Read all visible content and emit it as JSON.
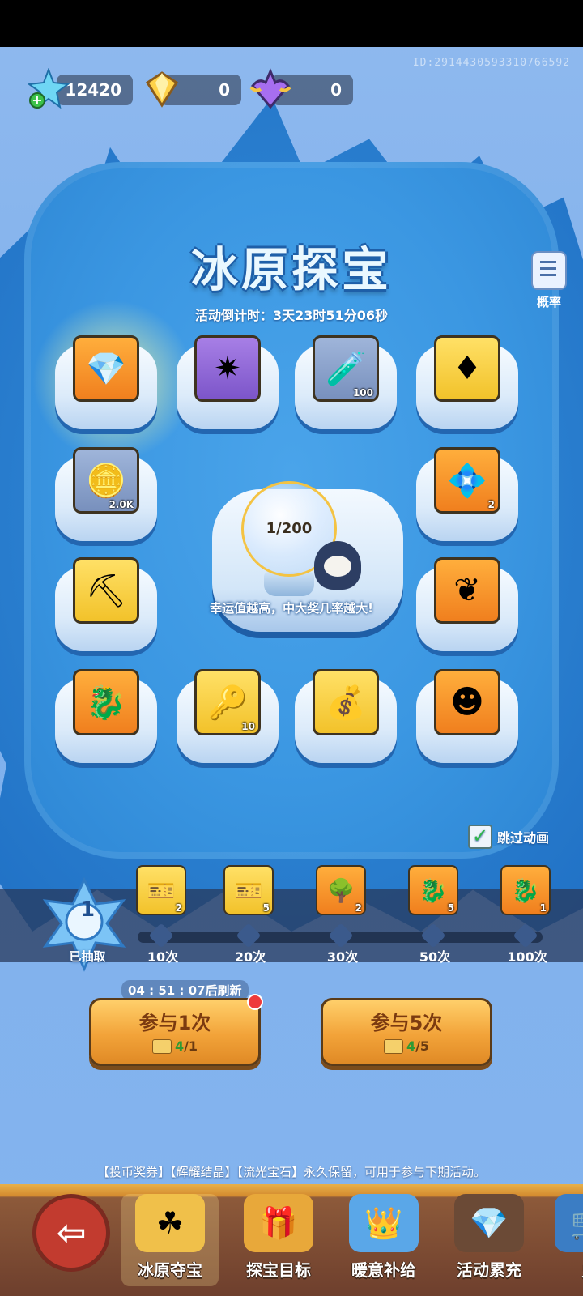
{
  "currency": {
    "snow_crystal": "12420",
    "gold_gem": "0",
    "purple_gem": "0"
  },
  "uid": "ID:2914430593310766592",
  "title": "冰原探宝",
  "countdown": "活动倒计时：3天23时51分06秒",
  "probability_label": "概率",
  "rewards": [
    {
      "icon": "purple-winged-gem-icon",
      "glyph": "💎",
      "color": "orange",
      "count": ""
    },
    {
      "icon": "star-shield-icon",
      "glyph": "✷",
      "color": "purple",
      "count": ""
    },
    {
      "icon": "potion-icon",
      "glyph": "🧪",
      "color": "blue",
      "count": "100"
    },
    {
      "icon": "gold-winged-gem-icon",
      "glyph": "♦",
      "color": "yellow",
      "count": ""
    },
    {
      "icon": "gold-coin-icon",
      "glyph": "🪙",
      "color": "blue",
      "count": "2.0K"
    },
    {
      "icon": "gold-crystal-icon",
      "glyph": "💠",
      "color": "orange",
      "count": "2"
    },
    {
      "icon": "pickaxe-icon",
      "glyph": "⛏",
      "color": "yellow",
      "count": ""
    },
    {
      "icon": "gold-wing-icon",
      "glyph": "❦",
      "color": "orange",
      "count": ""
    },
    {
      "icon": "dragon-puzzle-icon",
      "glyph": "🐉",
      "color": "orange",
      "count": ""
    },
    {
      "icon": "gold-key-icon",
      "glyph": "🔑",
      "color": "yellow",
      "count": "10"
    },
    {
      "icon": "coin-bag-icon",
      "glyph": "💰",
      "color": "yellow",
      "count": ""
    },
    {
      "icon": "purple-spirit-icon",
      "glyph": "☻",
      "color": "orange",
      "count": ""
    }
  ],
  "luck_value": "1/200",
  "luck_hint": "幸运值越高，中大奖几率越大!",
  "skip_animation": "跳过动画",
  "draw_count": "1",
  "draw_count_label": "已抽取",
  "milestones": [
    {
      "label": "10次",
      "icon": "ticket-icon",
      "glyph": "🎫",
      "count": "2",
      "color": "y"
    },
    {
      "label": "20次",
      "icon": "ticket-icon",
      "glyph": "🎫",
      "count": "5",
      "color": "y"
    },
    {
      "label": "30次",
      "icon": "tree-icon",
      "glyph": "🌳",
      "count": "2",
      "color": ""
    },
    {
      "label": "50次",
      "icon": "dragon-puzzle-icon",
      "glyph": "🐉",
      "count": "5",
      "color": ""
    },
    {
      "label": "100次",
      "icon": "dragon-puzzle-icon",
      "glyph": "🐉",
      "count": "1",
      "color": ""
    }
  ],
  "refresh_text": "04 : 51 : 07后刷新",
  "draw_once": {
    "label": "参与1次",
    "have": "4",
    "need": "/1"
  },
  "draw_five": {
    "label": "参与5次",
    "have": "4",
    "need": "/5"
  },
  "note": "【投币奖券】【辉耀结晶】【流光宝石】永久保留，可用于参与下期活动。",
  "nav": [
    {
      "label": "冰原夺宝",
      "icon": "clover-coin-icon",
      "glyph": "☘"
    },
    {
      "label": "探宝目标",
      "icon": "treasure-chest-icon",
      "glyph": "🎁"
    },
    {
      "label": "暖意补给",
      "icon": "crown-gem-icon",
      "glyph": "👑"
    },
    {
      "label": "活动累充",
      "icon": "gem-chest-icon",
      "glyph": "💎"
    },
    {
      "label": "兑",
      "icon": "exchange-icon",
      "glyph": "🛒"
    }
  ]
}
